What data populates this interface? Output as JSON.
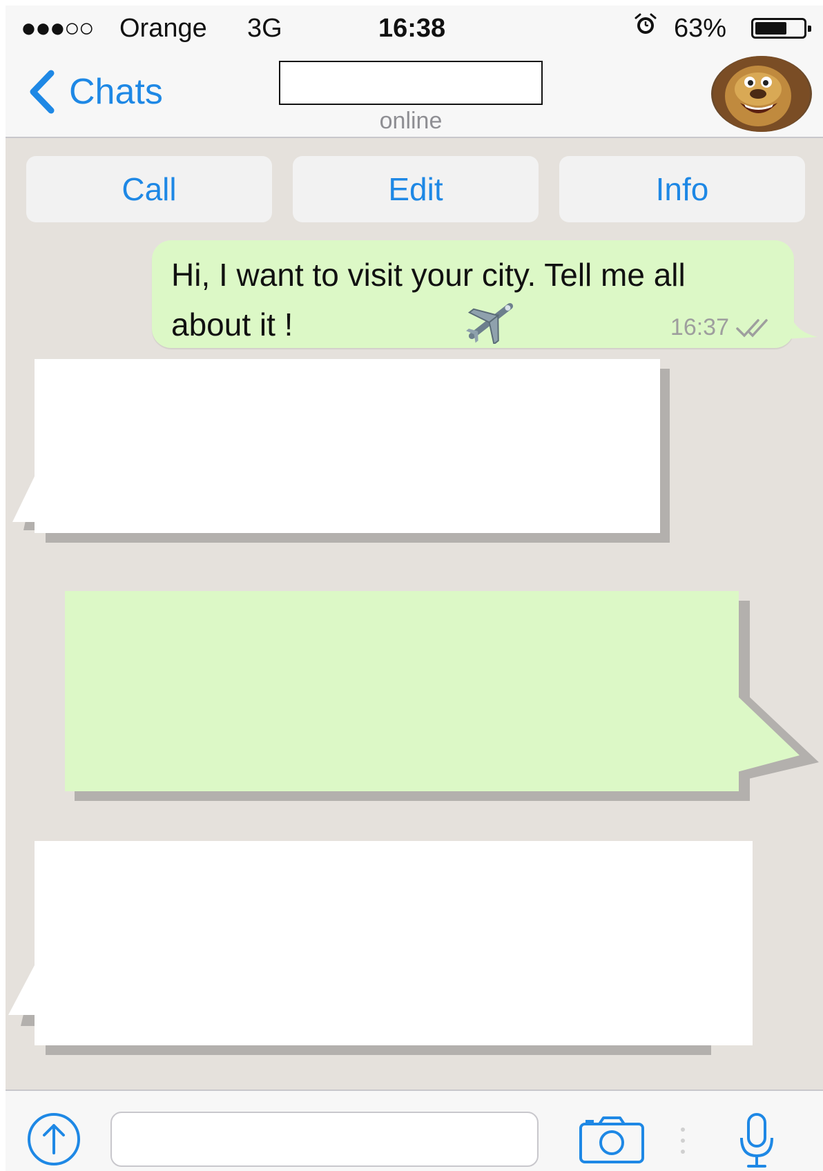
{
  "status_bar": {
    "signal": "●●●○○",
    "carrier": "Orange",
    "network": "3G",
    "time": "16:38",
    "alarm_icon": "alarm-clock-icon",
    "battery_percent": "63%",
    "battery_level": 0.63
  },
  "nav": {
    "back_label": "Chats",
    "contact_status": "online",
    "avatar_icon": "lion-avatar"
  },
  "actions": {
    "call": "Call",
    "edit": "Edit",
    "info": "Info"
  },
  "messages": [
    {
      "direction": "outgoing",
      "text": "Hi, I want to visit your city. Tell me all about it !",
      "emoji_icon": "airplane-icon",
      "time": "16:37",
      "status_icon": "double-check-icon"
    },
    {
      "direction": "incoming",
      "redacted": true
    },
    {
      "direction": "outgoing",
      "redacted": true
    },
    {
      "direction": "incoming",
      "redacted": true
    }
  ],
  "input_bar": {
    "message_value": "",
    "icons": [
      "share-icon",
      "camera-icon",
      "microphone-icon"
    ]
  },
  "colors": {
    "accent": "#1e88e5",
    "outgoing_bubble": "#dcf8c6",
    "incoming_bubble": "#ffffff",
    "chat_background": "#e5e1dc"
  }
}
